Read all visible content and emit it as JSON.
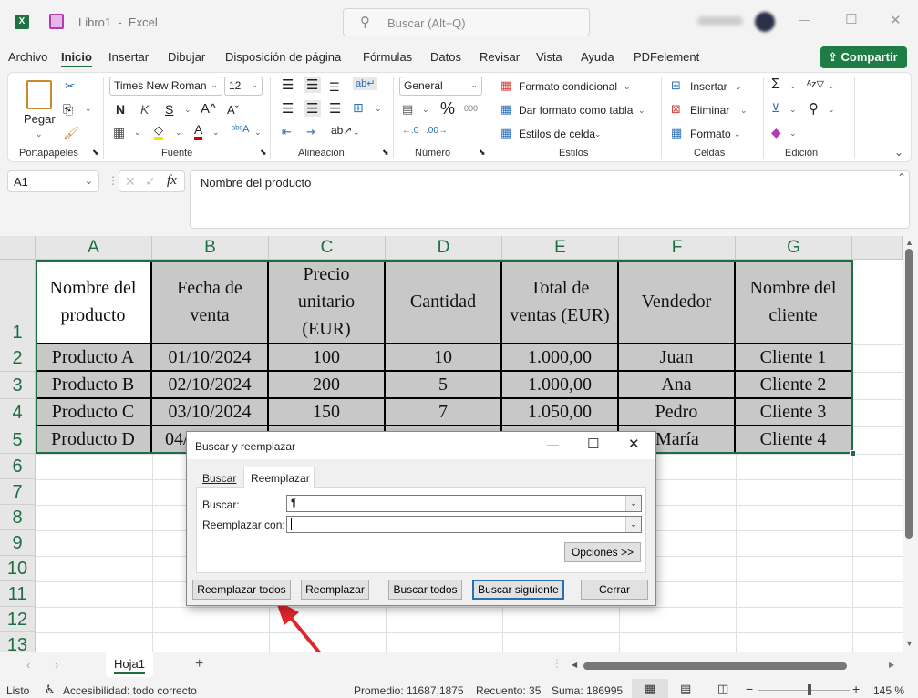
{
  "titlebar": {
    "app_icon": "excel-icon",
    "save_icon": "save-icon",
    "title": "Libro1  -  Excel",
    "search_placeholder": "Buscar (Alt+Q)",
    "minimize": "—",
    "maximize": "☐",
    "close": "✕"
  },
  "menu": {
    "items": [
      "Archivo",
      "Inicio",
      "Insertar",
      "Dibujar",
      "Disposición de página",
      "Fórmulas",
      "Datos",
      "Revisar",
      "Vista",
      "Ayuda",
      "PDFelement"
    ],
    "active": "Inicio",
    "share_label": "Compartir"
  },
  "ribbon": {
    "clipboard": {
      "paste": "Pegar",
      "label": "Portapapeles"
    },
    "font": {
      "name": "Times New Roman",
      "size": "12",
      "bold": "N",
      "italic": "K",
      "underline": "S",
      "grow": "A^",
      "shrink": "Aˇ",
      "label": "Fuente",
      "highlight_color": "#f5e500",
      "font_color": "#d40000"
    },
    "alignment": {
      "label": "Alineación"
    },
    "number": {
      "format": "General",
      "percent": "%",
      "thousands": "000",
      "label": "Número"
    },
    "styles": {
      "conditional": "Formato condicional",
      "as_table": "Dar formato como tabla",
      "cell_styles": "Estilos de celda",
      "label": "Estilos"
    },
    "cells": {
      "insert": "Insertar",
      "delete": "Eliminar",
      "format": "Formato",
      "label": "Celdas"
    },
    "editing": {
      "label": "Edición"
    }
  },
  "formula_bar": {
    "name_box": "A1",
    "fx": "fx",
    "content": "Nombre del producto"
  },
  "grid": {
    "columns": [
      "A",
      "B",
      "C",
      "D",
      "E",
      "F",
      "G"
    ],
    "rows": [
      "1",
      "2",
      "3",
      "4",
      "5",
      "6",
      "7",
      "8",
      "9",
      "10",
      "11",
      "12",
      "13"
    ],
    "header": [
      "Nombre del producto",
      "Fecha de venta",
      "Precio unitario (EUR)",
      "Cantidad",
      "Total de ventas (EUR)",
      "Vendedor",
      "Nombre del cliente"
    ],
    "data": [
      [
        "Producto A",
        "01/10/2024",
        "100",
        "10",
        "1.000,00",
        "Juan",
        "Cliente 1"
      ],
      [
        "Producto B",
        "02/10/2024",
        "200",
        "5",
        "1.000,00",
        "Ana",
        "Cliente 2"
      ],
      [
        "Producto C",
        "03/10/2024",
        "150",
        "7",
        "1.050,00",
        "Pedro",
        "Cliente 3"
      ],
      [
        "Producto D",
        "04/",
        "",
        "",
        "",
        "María",
        "Cliente 4"
      ]
    ],
    "accent": "#1e6e43"
  },
  "dialog": {
    "title": "Buscar y reemplazar",
    "tabs": [
      "Buscar",
      "Reemplazar"
    ],
    "active_tab": "Reemplazar",
    "find_label": "Buscar:",
    "find_value": "¶",
    "replace_label": "Reemplazar con:",
    "replace_value": "",
    "options": "Opciones >>",
    "buttons": [
      "Reemplazar todos",
      "Reemplazar",
      "Buscar todos",
      "Buscar siguiente",
      "Cerrar"
    ]
  },
  "sheets": {
    "tabs": [
      "Hoja1"
    ],
    "add": "+"
  },
  "status": {
    "ready": "Listo",
    "accessibility": "Accesibilidad: todo correcto",
    "average": "Promedio: 11687,1875",
    "count": "Recuento: 35",
    "sum": "Suma: 186995",
    "zoom": "145 %",
    "zoom_minus": "−",
    "zoom_plus": "+"
  },
  "annotation": {
    "arrow_color": "#e0262b"
  }
}
